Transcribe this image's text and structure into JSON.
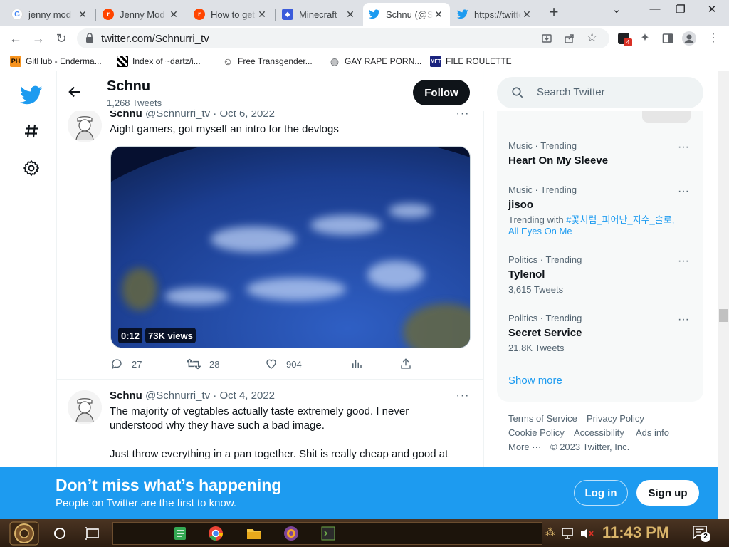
{
  "colors": {
    "twitter_blue": "#1d9bf0",
    "text_primary": "#0f1419",
    "text_secondary": "#536471"
  },
  "browser": {
    "tabs": [
      {
        "title": "jenny mod",
        "favicon": "google-icon"
      },
      {
        "title": "Jenny Mod",
        "favicon": "reddit-icon"
      },
      {
        "title": "How to get",
        "favicon": "reddit-icon"
      },
      {
        "title": "Minecraft",
        "favicon": "shield-icon"
      },
      {
        "title": "Schnu (@Schnurri_tv)",
        "favicon": "twitter-icon"
      },
      {
        "title": "https://twitter.com",
        "favicon": "twitter-icon"
      }
    ],
    "url": "twitter.com/Schnurri_tv",
    "extension_badge": "4",
    "bookmarks": [
      {
        "label": "GitHub - Enderma...",
        "icon": "ph-icon"
      },
      {
        "label": "Index of ~dartz/i...",
        "icon": "pixel-icon"
      },
      {
        "label": "Free Transgender...",
        "icon": "mask-icon"
      },
      {
        "label": "GAY RAPE PORN...",
        "icon": "globe-icon"
      },
      {
        "label": "FILE ROULETTE",
        "icon": "mft-icon"
      }
    ]
  },
  "profile": {
    "name": "Schnu",
    "tweet_count": "1,268 Tweets",
    "follow_label": "Follow"
  },
  "tweets": [
    {
      "name": "Schnu",
      "handle": "@Schnurri_tv",
      "sep": "·",
      "date": "Oct 6, 2022",
      "text": "Aight gamers, got myself an intro for the devlogs",
      "media": {
        "duration": "0:12",
        "views": "73K views"
      },
      "replies": "27",
      "retweets": "28",
      "likes": "904"
    },
    {
      "name": "Schnu",
      "handle": "@Schnurri_tv",
      "sep": "·",
      "date": "Oct 4, 2022",
      "text_lines": [
        "The majority of vegtables actually taste extremely good. I never",
        "understood why they have such a bad image.",
        "Just throw everything in a pan together. Shit is really cheap and good at"
      ]
    }
  ],
  "search": {
    "placeholder": "Search Twitter"
  },
  "trends": [
    {
      "meta": "Music · Trending",
      "name": "Heart On My Sleeve"
    },
    {
      "meta": "Music · Trending",
      "name": "jisoo",
      "sub_prefix": "Trending with",
      "sub_links": [
        "#꽃처럼_피어난_지수_솔로,",
        "All Eyes On Me"
      ]
    },
    {
      "meta": "Politics · Trending",
      "name": "Tylenol",
      "sub": "3,615 Tweets"
    },
    {
      "meta": "Politics · Trending",
      "name": "Secret Service",
      "sub": "21.8K Tweets"
    }
  ],
  "show_more": "Show more",
  "footer": {
    "row1": [
      "Terms of Service",
      "Privacy Policy"
    ],
    "row2": [
      "Cookie Policy",
      "Accessibility",
      "Ads info"
    ],
    "more": "More ···",
    "copyright": "© 2023 Twitter, Inc."
  },
  "banner": {
    "headline": "Don’t miss what’s happening",
    "subtext": "People on Twitter are the first to know.",
    "login_label": "Log in",
    "signup_label": "Sign up"
  },
  "taskbar": {
    "time": "11:43 PM",
    "notification_count": "2"
  }
}
